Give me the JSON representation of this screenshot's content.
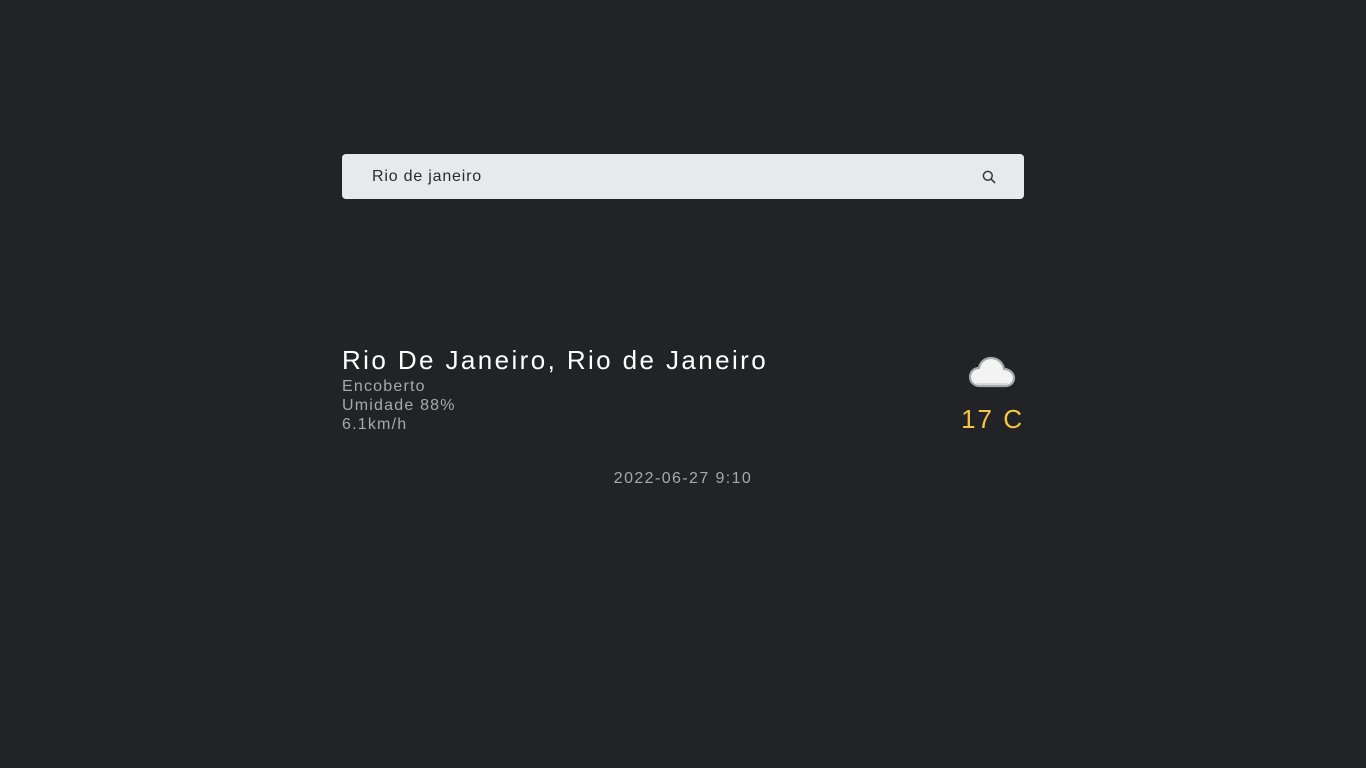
{
  "search": {
    "value": "Rio de janeiro",
    "icon": "search-icon"
  },
  "weather": {
    "location": "Rio De Janeiro, Rio de Janeiro",
    "condition": "Encoberto",
    "humidity": "Umidade 88%",
    "wind": "6.1km/h",
    "icon": "cloud-icon",
    "temperature": "17 C",
    "temperature_color": "#f5c542"
  },
  "datetime": "2022-06-27 9:10",
  "colors": {
    "background": "#222326",
    "search_background": "#e8e9ec",
    "primary_text": "#ffffff",
    "secondary_text": "#a7a8ab"
  }
}
